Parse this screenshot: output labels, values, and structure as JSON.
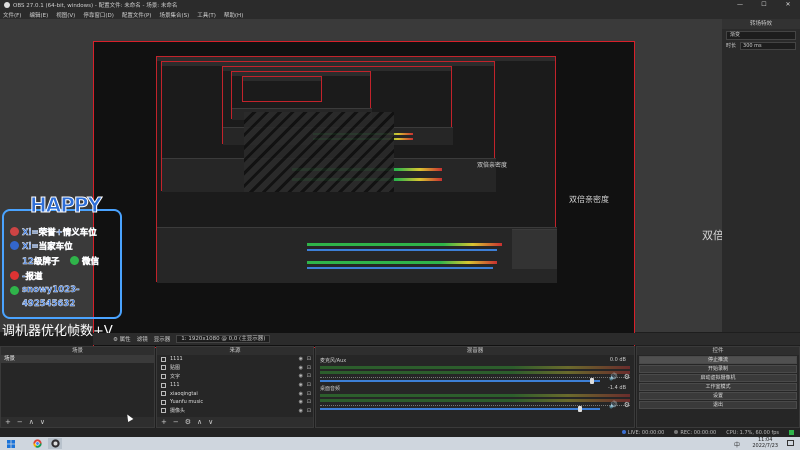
{
  "window": {
    "title": "OBS 27.0.1 (64-bit, windows) - 配置文件: 未命名 - 场景: 未命名",
    "minimize": "—",
    "maximize": "☐",
    "close": "✕"
  },
  "menu": [
    "文件(F)",
    "编辑(E)",
    "视图(V)",
    "停靠窗口(D)",
    "配置文件(P)",
    "场景集合(S)",
    "工具(T)",
    "帮助(H)"
  ],
  "transform_panel": {
    "title": "转场特效",
    "effect": "渐变",
    "duration_label": "时长",
    "duration_value": "300 ms"
  },
  "preview_text": {
    "double_large": "双倍亲密度",
    "double_mid": "双倍亲密度",
    "double_small": "双倍亲密度"
  },
  "overlay": {
    "happy": "HAPPY",
    "line1": "Xi=荣誉+情义车位",
    "line2": "Xi=当家车位",
    "line3": "12级牌子",
    "line3_suffix": "微信",
    "line4": "-报道",
    "line5": "snowy1023-",
    "line6": "492545632",
    "caption": "调机器优化帧数+V"
  },
  "props_bar": {
    "props": "⚙ 属性",
    "filters": "滤镜",
    "monitor_label": "显示器",
    "monitor_value": "1: 1920x1080 @ 0,0 (主显示器)"
  },
  "docks": {
    "scenes": {
      "title": "场景",
      "items": [
        "场景"
      ]
    },
    "sources": {
      "title": "来源",
      "items": [
        "1111",
        "贴图",
        "文字",
        "111",
        "xiaoqingtai",
        "Yuanfu music",
        "摄像头"
      ]
    },
    "mixer": {
      "title": "混音器",
      "channels": [
        {
          "name": "麦克风/Aux",
          "db": "0.0 dB",
          "level": 0.0,
          "fader": 0.97
        },
        {
          "name": "桌面音频",
          "db": "-1.4 dB",
          "level": 0.0,
          "fader": 0.93
        }
      ]
    },
    "controls": {
      "title": "控件",
      "buttons": [
        "停止推流",
        "开始录制",
        "启动虚拟摄像机",
        "工作室模式",
        "设置",
        "退出"
      ]
    }
  },
  "dock_footer": {
    "add": "+",
    "remove": "−",
    "up": "∧",
    "down": "∨",
    "gear": "⚙"
  },
  "status": {
    "live": "LIVE: 00:00:00",
    "rec": "REC: 00:00:00",
    "cpu": "CPU: 1.7%, 60.00 fps"
  },
  "taskbar": {
    "time": "11:04",
    "date": "2022/7/23",
    "lang": "中"
  }
}
